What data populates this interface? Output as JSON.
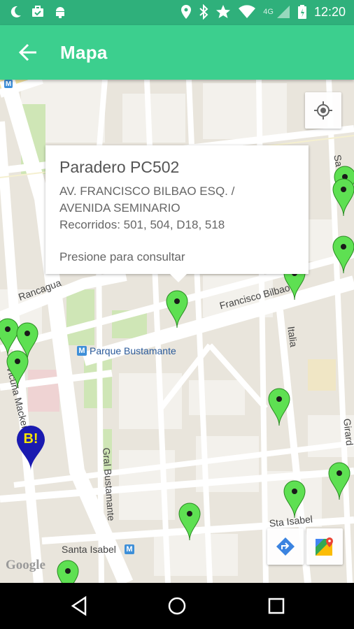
{
  "status_bar": {
    "time": "12:20",
    "network": "4G",
    "left_icons": [
      "moon-icon",
      "briefcase-icon",
      "android-icon"
    ],
    "right_icons": [
      "location-icon",
      "bluetooth-icon",
      "star-icon",
      "wifi-icon",
      "signal-icon",
      "battery-icon"
    ]
  },
  "app_bar": {
    "title": "Mapa"
  },
  "map": {
    "streets": {
      "francisco_bilbao": "Francisco Bilbao",
      "rancagua": "Rancagua",
      "vicuna_mackenna": "Vicuña Macken",
      "gral_bustamante": "Gral Bustamante",
      "italia": "Italia",
      "sta_isabel": "Sta Isabel",
      "santa_isabel": "Santa Isabel",
      "girardi": "Girard",
      "sa": "Sa"
    },
    "metro": {
      "parque_bustamante": "Parque Bustamante",
      "santa_isabel_badge": "M",
      "badge": "M"
    },
    "logo": "Google",
    "bip_badge": "B!"
  },
  "info_window": {
    "title": "Paradero PC502",
    "address_line1": "AV. FRANCISCO BILBAO ESQ. /",
    "address_line2": "AVENIDA SEMINARIO",
    "routes": "Recorridos: 501, 504, D18, 518",
    "hint": "Presione para consultar"
  },
  "colors": {
    "status_bar": "#2fb07b",
    "app_bar": "#3ccf8e",
    "marker": "#5ee052",
    "bip_marker": "#1a1ab0",
    "bip_text": "#f5e400"
  }
}
